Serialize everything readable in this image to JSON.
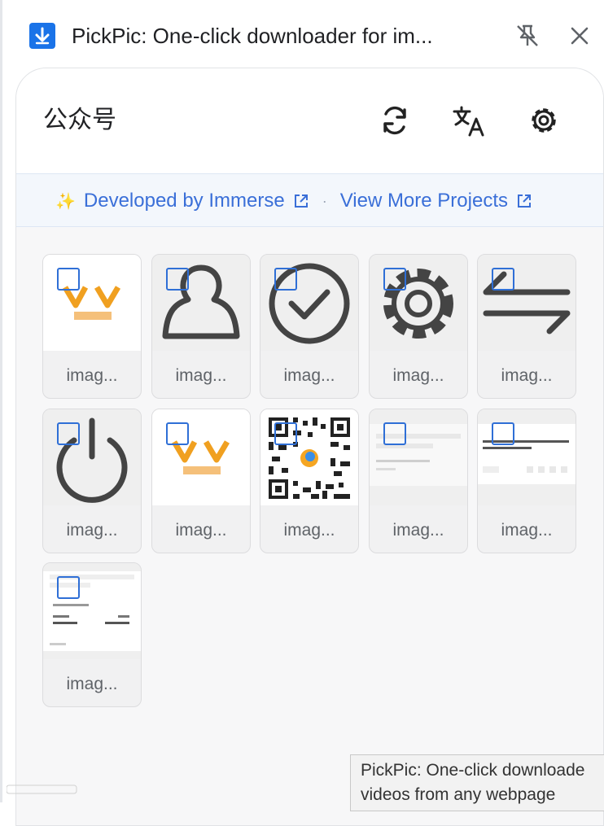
{
  "header": {
    "title": "PickPic: One-click downloader for im...",
    "logo_icon": "download-arrow-icon",
    "pin_icon": "unpin-icon",
    "close_icon": "close-icon"
  },
  "panel": {
    "title": "公众号",
    "toolbar": {
      "refresh_icon": "refresh-icon",
      "translate_icon": "translate-icon",
      "settings_icon": "gear-icon"
    }
  },
  "banner": {
    "sparkle": "✨",
    "developed_by": "Developed by Immerse",
    "separator": "·",
    "view_more": "View More Projects"
  },
  "images": [
    {
      "caption": "imag...",
      "kind": "logo-v"
    },
    {
      "caption": "imag...",
      "kind": "user-icon"
    },
    {
      "caption": "imag...",
      "kind": "check-circle-icon"
    },
    {
      "caption": "imag...",
      "kind": "gear-icon"
    },
    {
      "caption": "imag...",
      "kind": "swap-arrows-icon"
    },
    {
      "caption": "imag...",
      "kind": "power-icon"
    },
    {
      "caption": "imag...",
      "kind": "logo-v"
    },
    {
      "caption": "imag...",
      "kind": "qr-code"
    },
    {
      "caption": "imag...",
      "kind": "article-screenshot"
    },
    {
      "caption": "imag...",
      "kind": "article-screenshot"
    },
    {
      "caption": "imag...",
      "kind": "article-screenshot"
    }
  ],
  "tooltip": {
    "line1": "PickPic: One-click downloade",
    "line2": "videos from any webpage"
  },
  "colors": {
    "accent": "#1a73e8",
    "link": "#3a6fd8",
    "checkbox": "#2f6fd6",
    "logo_orange": "#f0a020"
  }
}
